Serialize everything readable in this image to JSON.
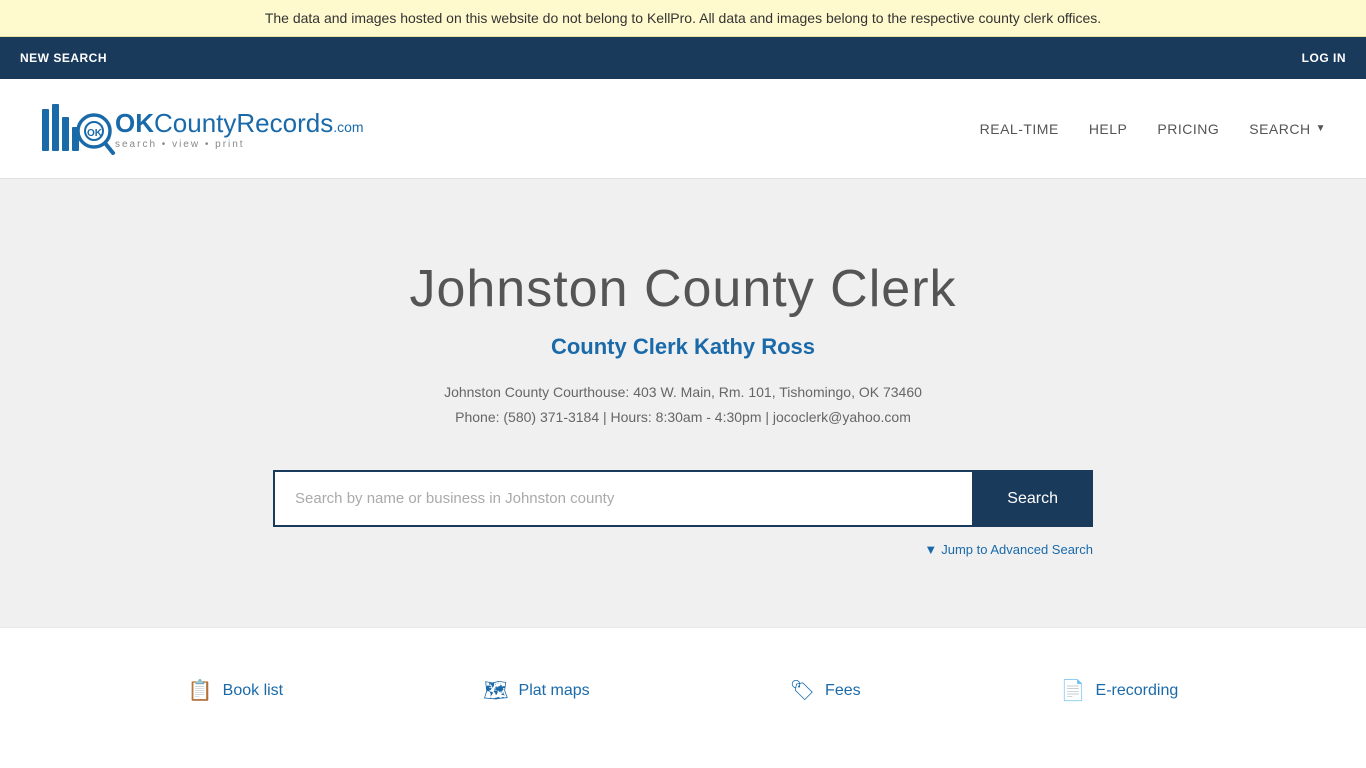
{
  "notification": {
    "text": "The data and images hosted on this website do not belong to KellPro. All data and images belong to the respective county clerk offices."
  },
  "topNav": {
    "newSearch": "NEW SEARCH",
    "logIn": "LOG IN"
  },
  "header": {
    "logoText": "OKCountyRecords",
    "logoDotCom": ".com",
    "logoTagline": "search • view • print",
    "nav": {
      "realTime": "REAL-TIME",
      "help": "HELP",
      "pricing": "PRICING",
      "search": "SEARCH"
    }
  },
  "hero": {
    "countyTitle": "Johnston County Clerk",
    "clerkName": "County Clerk Kathy Ross",
    "addressLine1": "Johnston County Courthouse: 403 W. Main, Rm. 101, Tishomingo, OK 73460",
    "addressLine2": "Phone: (580) 371-3184 | Hours: 8:30am - 4:30pm | jococlerk@yahoo.com",
    "searchPlaceholder": "Search by name or business in Johnston county",
    "searchButton": "Search",
    "advancedSearch": "Jump to Advanced Search"
  },
  "footerLinks": [
    {
      "icon": "📋",
      "label": "Book list"
    },
    {
      "icon": "🗺",
      "label": "Plat maps"
    },
    {
      "icon": "🏷",
      "label": "Fees"
    },
    {
      "icon": "📄",
      "label": "E-recording"
    }
  ],
  "colors": {
    "primary": "#1a3a5c",
    "accent": "#1a6aaa",
    "bannerBg": "#fffacd",
    "heroBg": "#f0f0f0"
  }
}
